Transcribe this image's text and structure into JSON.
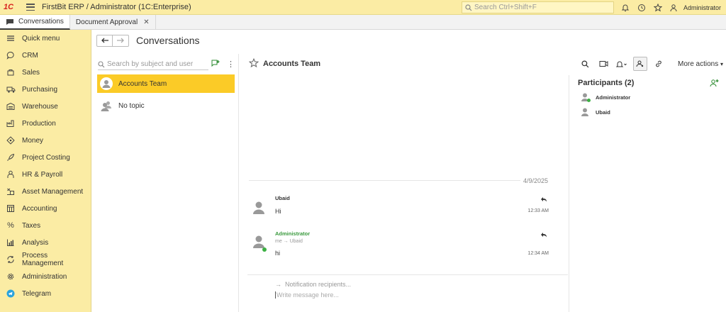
{
  "app": {
    "title": "FirstBit ERP / Administrator  (1C:Enterprise)",
    "search_placeholder": "Search Ctrl+Shift+F",
    "user": "Administrator"
  },
  "tabs": [
    {
      "label": "Conversations"
    },
    {
      "label": "Document Approval"
    }
  ],
  "sidebar": {
    "items": [
      {
        "label": "Quick menu",
        "icon": "hamburger-icon"
      },
      {
        "label": "CRM",
        "icon": "chat-bubble-icon"
      },
      {
        "label": "Sales",
        "icon": "cart-icon"
      },
      {
        "label": "Purchasing",
        "icon": "truck-icon"
      },
      {
        "label": "Warehouse",
        "icon": "warehouse-icon"
      },
      {
        "label": "Production",
        "icon": "factory-icon"
      },
      {
        "label": "Money",
        "icon": "money-icon"
      },
      {
        "label": "Project Costing",
        "icon": "rocket-icon"
      },
      {
        "label": "HR & Payroll",
        "icon": "person-icon"
      },
      {
        "label": "Asset Management",
        "icon": "asset-icon"
      },
      {
        "label": "Accounting",
        "icon": "ledger-icon"
      },
      {
        "label": "Taxes",
        "icon": "percent-icon"
      },
      {
        "label": "Analysis",
        "icon": "chart-icon"
      },
      {
        "label": "Process Management",
        "icon": "cycle-icon"
      },
      {
        "label": "Administration",
        "icon": "gear-icon"
      },
      {
        "label": "Telegram",
        "icon": "telegram-icon"
      }
    ]
  },
  "main": {
    "title": "Conversations"
  },
  "conversations": {
    "search_placeholder": "Search by subject and user",
    "more": "⋮",
    "items": [
      {
        "label": "Accounts Team",
        "selected": true
      },
      {
        "label": "No topic",
        "selected": false
      }
    ]
  },
  "chat": {
    "title": "Accounts Team",
    "more_actions": "More actions",
    "date": "4/9/2025",
    "messages": [
      {
        "author": "Ubaid",
        "text": "Hi",
        "time": "12:33 AM",
        "sub": ""
      },
      {
        "author": "Administrator",
        "text": "hi",
        "time": "12:34 AM",
        "sub": "me → Ubaid"
      }
    ],
    "notification_placeholder": "Notification recipients...",
    "compose_placeholder": "Write message here..."
  },
  "participants": {
    "title": "Participants (2)",
    "items": [
      {
        "name": "Administrator",
        "online": true
      },
      {
        "name": "Ubaid",
        "online": false
      }
    ]
  },
  "colors": {
    "accent": "#fbcb27",
    "sidebar": "#fbeca4",
    "online": "#3cb043"
  }
}
